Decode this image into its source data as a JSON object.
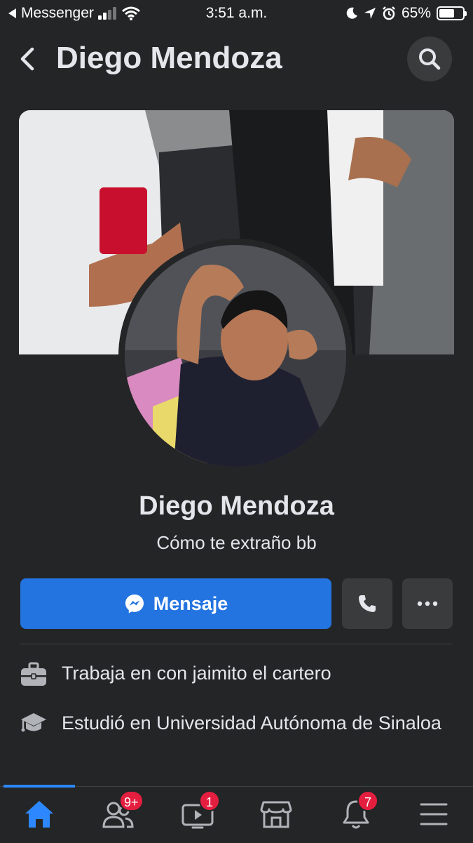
{
  "status_bar": {
    "back_app": "Messenger",
    "time": "3:51 a.m.",
    "battery": "65%",
    "battery_level": 0.65
  },
  "header": {
    "title": "Diego Mendoza"
  },
  "profile": {
    "name": "Diego Mendoza",
    "bio": "Cómo te extraño bb"
  },
  "actions": {
    "message_label": "Mensaje"
  },
  "info": [
    {
      "icon": "briefcase-icon",
      "text": "Trabaja en con jaimito el cartero"
    },
    {
      "icon": "graduation-cap-icon",
      "text": "Estudió en Universidad Autónoma de Sinaloa"
    }
  ],
  "nav": {
    "friends_badge": "9+",
    "watch_badge": "1",
    "notifications_badge": "7"
  },
  "colors": {
    "background": "#242526",
    "accent": "#2374e1",
    "badge": "#e41e3f"
  }
}
